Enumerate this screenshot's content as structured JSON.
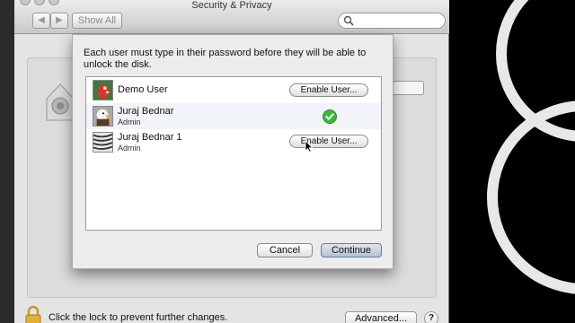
{
  "window": {
    "title": "Security & Privacy",
    "show_all_label": "Show All",
    "back_glyph": "◀",
    "forward_glyph": "▶"
  },
  "search": {
    "placeholder": "",
    "icon": "search-icon"
  },
  "sheet": {
    "message": "Each user must type in their password before they will be able to unlock the disk.",
    "users": [
      {
        "name": "Demo User",
        "role": "",
        "action_label": "Enable User...",
        "enabled": false,
        "avatar": "parrot"
      },
      {
        "name": "Juraj Bednar",
        "role": "Admin",
        "action_label": "",
        "enabled": true,
        "avatar": "eagle"
      },
      {
        "name": "Juraj Bednar 1",
        "role": "Admin",
        "action_label": "Enable User...",
        "enabled": false,
        "avatar": "zebra"
      }
    ],
    "cancel_label": "Cancel",
    "continue_label": "Continue"
  },
  "footer": {
    "lock_text": "Click the lock to prevent further changes.",
    "advanced_label": "Advanced...",
    "help_label": "?"
  },
  "colors": {
    "window_bg": "#e4e4e4",
    "sheet_bg": "#ececec",
    "default_button": "#b3c1d6",
    "check_green": "#3db83d",
    "desktop_bg": "#000000"
  }
}
